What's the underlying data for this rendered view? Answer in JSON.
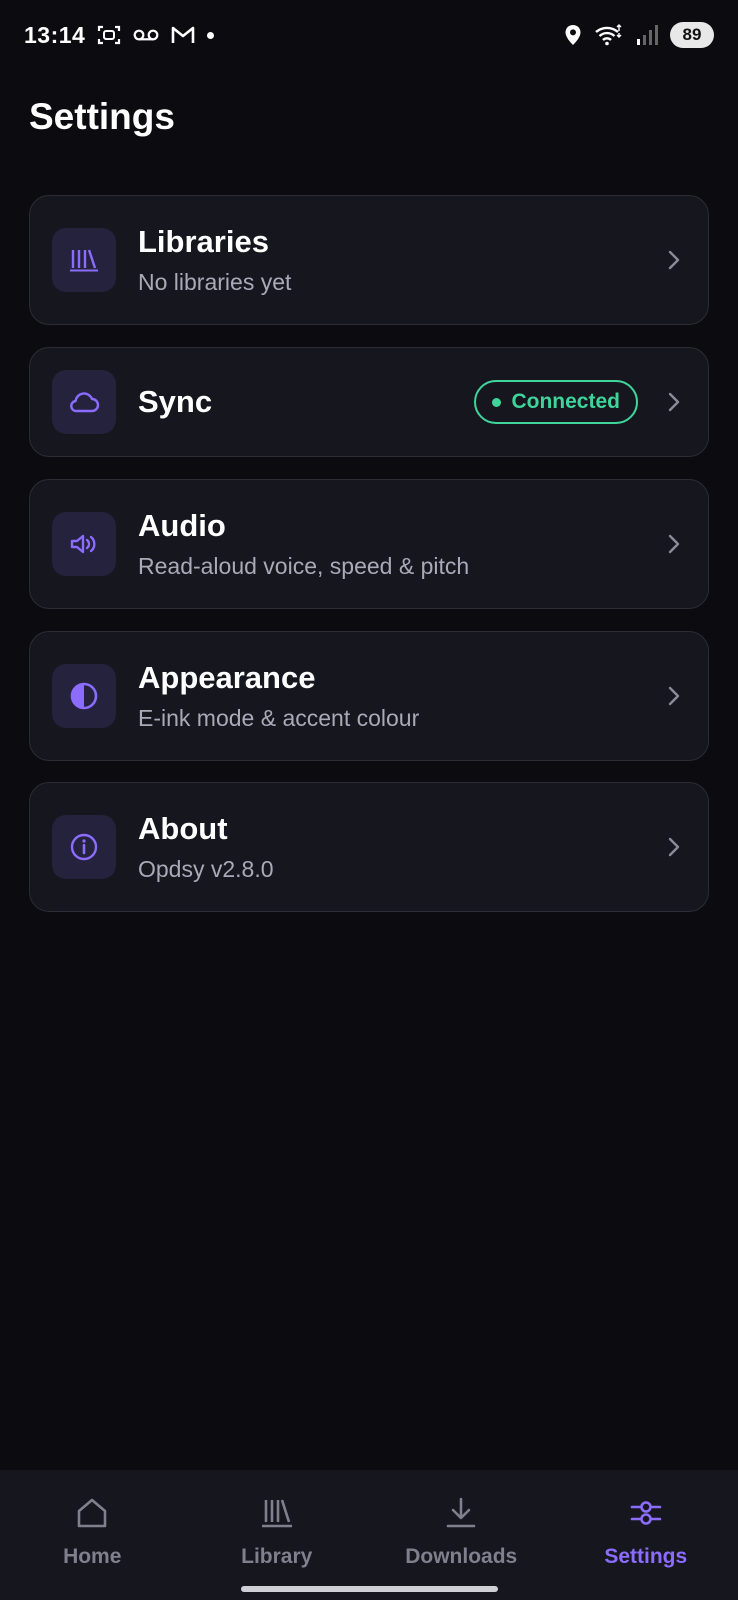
{
  "status_bar": {
    "time": "13:14",
    "battery": "89",
    "icons": [
      "face-scan-icon",
      "voicemail-icon",
      "gmail-icon",
      "notification-dot",
      "location-icon",
      "wifi-icon",
      "signal-icon",
      "battery-icon"
    ]
  },
  "page": {
    "title": "Settings"
  },
  "settings": [
    {
      "key": "libraries",
      "title": "Libraries",
      "subtitle": "No libraries yet",
      "icon": "libraries-icon"
    },
    {
      "key": "sync",
      "title": "Sync",
      "badge": "Connected",
      "icon": "cloud-icon"
    },
    {
      "key": "audio",
      "title": "Audio",
      "subtitle": "Read-aloud voice, speed & pitch",
      "icon": "speaker-icon"
    },
    {
      "key": "appearance",
      "title": "Appearance",
      "subtitle": "E-ink mode & accent colour",
      "icon": "contrast-icon"
    },
    {
      "key": "about",
      "title": "About",
      "subtitle": "Opdsy v2.8.0",
      "icon": "info-icon"
    }
  ],
  "nav": [
    {
      "label": "Home",
      "icon": "home-icon",
      "active": false
    },
    {
      "label": "Library",
      "icon": "library-icon",
      "active": false
    },
    {
      "label": "Downloads",
      "icon": "download-icon",
      "active": false
    },
    {
      "label": "Settings",
      "icon": "sliders-icon",
      "active": true
    }
  ],
  "colors": {
    "background": "#0b0b10",
    "card": "#16161e",
    "accent": "#8b6cff",
    "connected": "#3fd49a",
    "muted_text": "#a9a9b8"
  }
}
